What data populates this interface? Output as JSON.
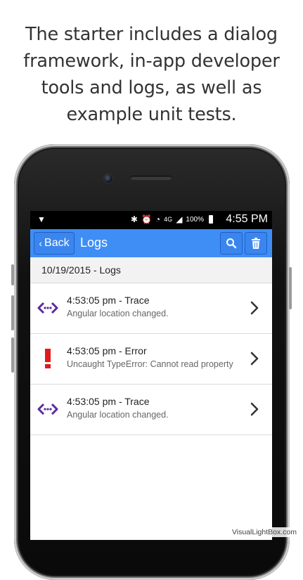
{
  "headline": {
    "line1": "The starter includes a dialog",
    "line2": "framework, in-app developer",
    "line3": "tools and logs, as well as",
    "line4": "example unit tests."
  },
  "status_bar": {
    "network_icon": "signal-y-icon",
    "battery_percent": "100%",
    "time": "4:55 PM",
    "lte_label": "4G"
  },
  "navbar": {
    "back_label": "Back",
    "title": "Logs",
    "search_icon": "search-icon",
    "trash_icon": "trash-icon",
    "color": "#3f8ef6"
  },
  "date_header": "10/19/2015 - Logs",
  "logs": [
    {
      "title": "4:53:05 pm - Trace",
      "message": "Angular location changed.",
      "icon": "trace-icon"
    },
    {
      "title": "4:53:05 pm - Error",
      "message": "Uncaught TypeError: Cannot read property",
      "icon": "error-icon"
    },
    {
      "title": "4:53:05 pm - Trace",
      "message": "Angular location changed.",
      "icon": "trace-icon"
    }
  ],
  "watermark": "VisualLightBox.com"
}
